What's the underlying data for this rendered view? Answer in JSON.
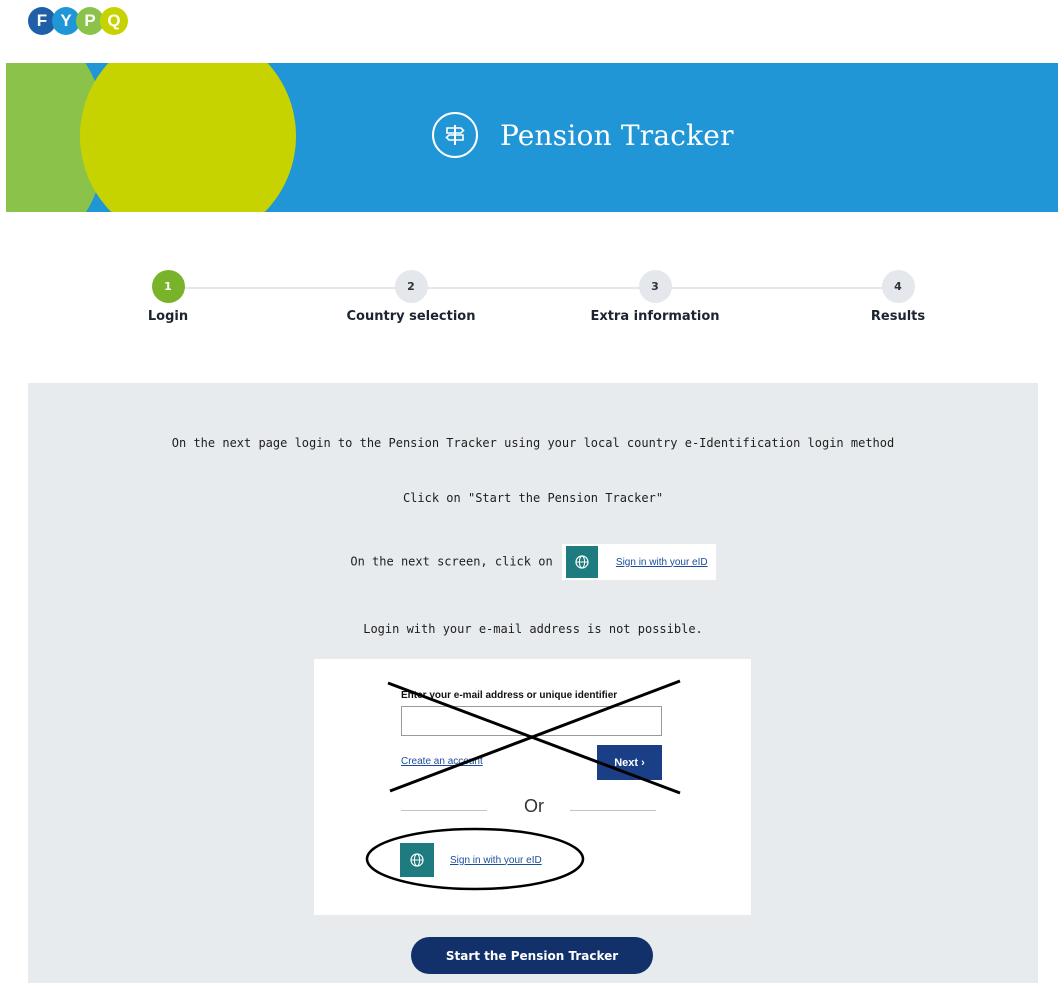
{
  "logo": {
    "letters": [
      "F",
      "Y",
      "P",
      "Q"
    ],
    "colors": [
      "#1f5fa8",
      "#2196d6",
      "#8bc34a",
      "#c7d300"
    ]
  },
  "banner": {
    "title": "Pension Tracker",
    "icon": "signpost-icon",
    "colors": {
      "background": "#2196d6",
      "circle_green": "#8bc34a",
      "circle_lime": "#c7d300"
    }
  },
  "stepper": {
    "active_step": 1,
    "steps": [
      {
        "number": "1",
        "label": "Login"
      },
      {
        "number": "2",
        "label": "Country selection"
      },
      {
        "number": "3",
        "label": "Extra information"
      },
      {
        "number": "4",
        "label": "Results"
      }
    ],
    "active_color": "#78b32a"
  },
  "instructions": {
    "line1": "On the next page login to the Pension Tracker using your local country e-Identification login method",
    "line2": "Click on \"Start the Pension Tracker\"",
    "line3_prefix": "On the next screen, click on",
    "eid_link": "Sign in with your eID",
    "line4": "Login with your e-mail address is not possible."
  },
  "example_login": {
    "field_label": "Enter your e-mail address or unique identifier",
    "create_account": "Create an account",
    "next_button": "Next ›",
    "or_text": "Or",
    "eid_link": "Sign in with your eID",
    "eid_icon": "globe-icon"
  },
  "start_button": {
    "label": "Start the Pension Tracker",
    "color": "#12316a"
  }
}
